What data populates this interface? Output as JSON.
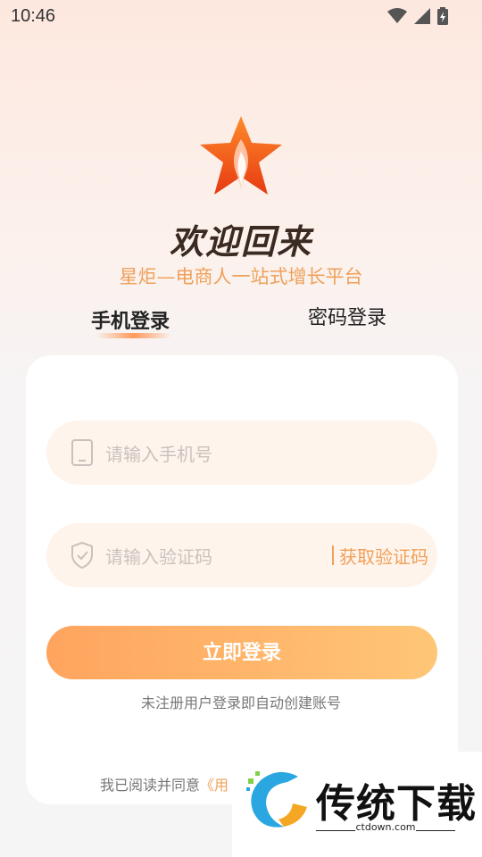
{
  "status_bar": {
    "time": "10:46",
    "icons": [
      "wifi-icon",
      "signal-icon",
      "battery-icon"
    ]
  },
  "header": {
    "logo_icon": "torch-star-icon",
    "welcome": "欢迎回来",
    "subtitle": "星炬—电商人一站式增长平台"
  },
  "tabs": [
    {
      "label": "手机登录",
      "active": true
    },
    {
      "label": "密码登录",
      "active": false
    }
  ],
  "form": {
    "phone": {
      "placeholder": "请输入手机号",
      "icon": "phone-icon"
    },
    "code": {
      "placeholder": "请输入验证码",
      "icon": "shield-icon",
      "get_code_label": "获取验证码"
    },
    "submit_label": "立即登录",
    "note": "未注册用户登录即自动创建账号"
  },
  "agreement": {
    "text": "我已阅读并同意",
    "link_visible": "《用"
  },
  "watermark": {
    "title": "传统下载",
    "url": "ctdown.com"
  },
  "colors": {
    "accent": "#f0a05a",
    "button_start": "#ffa45e",
    "button_end": "#ffc677",
    "input_bg": "#fff4ec"
  }
}
